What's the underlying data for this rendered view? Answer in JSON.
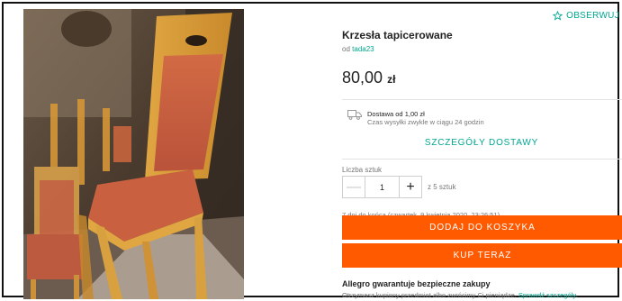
{
  "header": {
    "follow_label": "OBSERWUJ"
  },
  "product": {
    "title": "Krzesła tapicerowane",
    "seller_prefix": "od",
    "seller_name": "tada23",
    "price_main": "80,00",
    "price_currency": "zł"
  },
  "delivery": {
    "cost": "Dostawa od 1,00 zł",
    "time": "Czas wysyłki zwykle w ciągu 24 godzin",
    "details_link": "SZCZEGÓŁY DOSTAWY"
  },
  "quantity": {
    "label": "Liczba sztuk",
    "minus": "—",
    "value": "1",
    "plus": "+",
    "stock": "z 5 sztuk"
  },
  "offer_end": "7 dni do końca (czwartek, 9 kwietnia 2020, 23:26:51)",
  "actions": {
    "add_to_cart": "DODAJ DO KOSZYKA",
    "buy_now": "KUP TERAZ"
  },
  "guarantee": {
    "title": "Allegro gwarantuje bezpieczne zakupy",
    "text": "Otrzymasz kupiony przedmiot albo zwrócimy Ci pieniądze.",
    "link": "Sprawdź szczegóły."
  },
  "colors": {
    "accent": "#00a790",
    "orange": "#ff5a00",
    "text": "#222222",
    "muted": "#767676"
  }
}
